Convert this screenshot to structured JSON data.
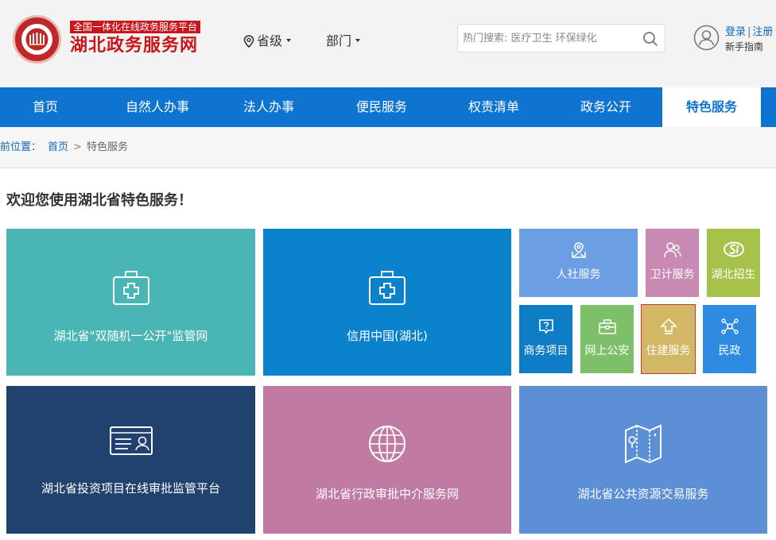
{
  "header": {
    "tagline": "全国一体化在线政务服务平台",
    "site_name": "湖北政务服务网",
    "province_selector": "省级",
    "department_selector": "部门",
    "search_placeholder": "热门搜索: 医疗卫生 环保绿化",
    "login": "登录",
    "register": "注册",
    "separator": "|",
    "guide": "新手指南"
  },
  "nav": {
    "items": [
      {
        "label": "首页"
      },
      {
        "label": "自然人办事"
      },
      {
        "label": "法人办事"
      },
      {
        "label": "便民服务"
      },
      {
        "label": "权责清单"
      },
      {
        "label": "政务公开"
      },
      {
        "label": "特色服务"
      }
    ],
    "active_index": 6
  },
  "breadcrumb": {
    "label": "前位置：",
    "home": "首页",
    "arrow": ">",
    "current": "特色服务"
  },
  "main": {
    "welcome": "欢迎您使用湖北省特色服务！",
    "tiles": {
      "supervision": "湖北省\"双随机一公开\"监管网",
      "credit": "信用中国(湖北)",
      "social_security": "人社服务",
      "health": "卫计服务",
      "recruit": "湖北招生",
      "commerce": "商务项目",
      "police": "网上公安",
      "housing": "住建服务",
      "civil": "民政",
      "investment": "湖北省投资项目在线审批监管平台",
      "intermediary": "湖北省行政审批中介服务网",
      "resource": "湖北省公共资源交易服务"
    }
  },
  "colors": {
    "brand_red": "#c8161d",
    "nav_blue": "#0f74d0",
    "teal": "#4ab5b5",
    "blue": "#0b82cc",
    "periwinkle": "#6c9ee3",
    "mauve": "#c88ab3",
    "olive_green": "#a7c24a",
    "deep_blue": "#0e7dc6",
    "green": "#7ec06a",
    "gold": "#d2b765",
    "bright_blue": "#2e8be0",
    "navy": "#21416f",
    "pink_mauve": "#c07ba2",
    "steel_blue": "#5c8fd6"
  }
}
